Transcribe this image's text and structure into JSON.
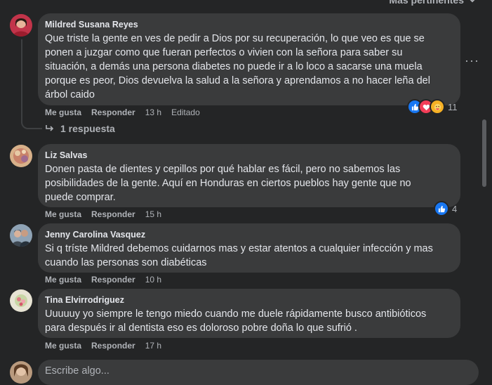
{
  "sort": {
    "label": "Más pertinentes"
  },
  "comments": [
    {
      "author": "Mildred Susana Reyes",
      "text": "Que triste la gente en ves de pedir a Dios por su recuperación, lo que veo es que se\nponen a juzgar como que fueran perfectos o vivien con la señora para saber su\nsituación, a demás una persona diabetes no puede ir a lo loco a sacarse una muela\nporque es peor, Dios devuelva la salud a la señora y aprendamos a no hacer leña del\nárbol caido",
      "like": "Me gusta",
      "reply": "Responder",
      "time": "13 h",
      "edited": "Editado",
      "reactions_count": "11",
      "replies_label": "1 respuesta"
    },
    {
      "author": "Liz Salvas",
      "text": "Donen pasta de dientes y cepillos por qué hablar es fácil, pero no sabemos las\nposibilidades de la gente. Aquí en Honduras en ciertos pueblos hay gente que no\npuede comprar.",
      "like": "Me gusta",
      "reply": "Responder",
      "time": "15 h",
      "reactions_count": "4"
    },
    {
      "author": "Jenny Carolina Vasquez",
      "text": "Si q tríste Mildred debemos cuidarnos mas y estar atentos a cualquier infección y mas\ncuando las personas son diabéticas",
      "like": "Me gusta",
      "reply": "Responder",
      "time": "10 h"
    },
    {
      "author": "Tina Elvirrodriguez",
      "text": "Uuuuuy yo siempre le tengo miedo cuando me duele rápidamente busco antibióticos\npara después ir al dentista eso es doloroso pobre doña lo que sufrió .",
      "like": "Me gusta",
      "reply": "Responder",
      "time": "17 h"
    }
  ],
  "composer": {
    "placeholder": "Escribe algo..."
  },
  "colors": {
    "background": "#242526",
    "bubble": "#3a3b3c",
    "like_blue": "#1877f2",
    "love_red": "#f33e58",
    "care_yellow": "#f7b125"
  },
  "icons": [
    "chevron-down-icon",
    "more-icon",
    "reply-arrow-icon",
    "like-icon",
    "love-icon",
    "care-icon"
  ]
}
